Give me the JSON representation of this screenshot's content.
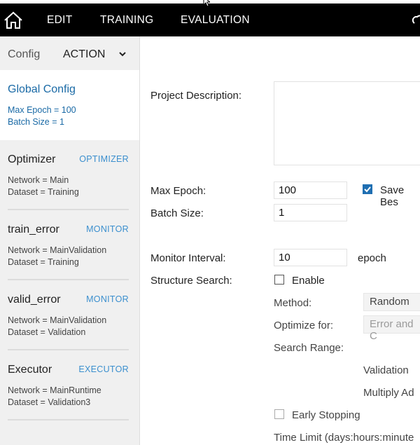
{
  "menu": {
    "items": [
      {
        "label": "EDIT"
      },
      {
        "label": "TRAINING"
      },
      {
        "label": "EVALUATION"
      }
    ]
  },
  "sidebar": {
    "tab_label": "Config",
    "dropdown_value": "ACTION",
    "cards": [
      {
        "title": "Global Config",
        "type": "",
        "lines": [
          "Max Epoch = 100",
          "Batch Size = 1"
        ],
        "selected": true
      },
      {
        "title": "Optimizer",
        "type": "OPTIMIZER",
        "lines": [
          "Network = Main",
          "Dataset = Training"
        ]
      },
      {
        "title": "train_error",
        "type": "MONITOR",
        "lines": [
          "Network = MainValidation",
          "Dataset = Training"
        ]
      },
      {
        "title": "valid_error",
        "type": "MONITOR",
        "lines": [
          "Network = MainValidation",
          "Dataset = Validation"
        ]
      },
      {
        "title": "Executor",
        "type": "EXECUTOR",
        "lines": [
          "Network = MainRuntime",
          "Dataset = Validation3"
        ]
      }
    ]
  },
  "form": {
    "project_description_label": "Project Description:",
    "project_description_value": "",
    "max_epoch_label": "Max Epoch:",
    "max_epoch_value": "100",
    "save_best_label": "Save Bes",
    "batch_size_label": "Batch Size:",
    "batch_size_value": "1",
    "monitor_interval_label": "Monitor Interval:",
    "monitor_interval_value": "10",
    "monitor_interval_unit": "epoch",
    "structure_search_label": "Structure Search:",
    "enable_label": "Enable",
    "method_label": "Method:",
    "method_value": "Random",
    "optimize_for_label": "Optimize for:",
    "optimize_for_value": "Error and C",
    "search_range_label": "Search Range:",
    "validation_label": "Validation",
    "multiply_label": "Multiply Ad",
    "early_stopping_label": "Early Stopping",
    "time_limit_label": "Time Limit (days:hours:minute"
  },
  "colors": {
    "topbar": "#000000",
    "accent": "#1f6fb2",
    "selected_text": "#1a6aa6",
    "type_tag": "#3b8fce"
  }
}
